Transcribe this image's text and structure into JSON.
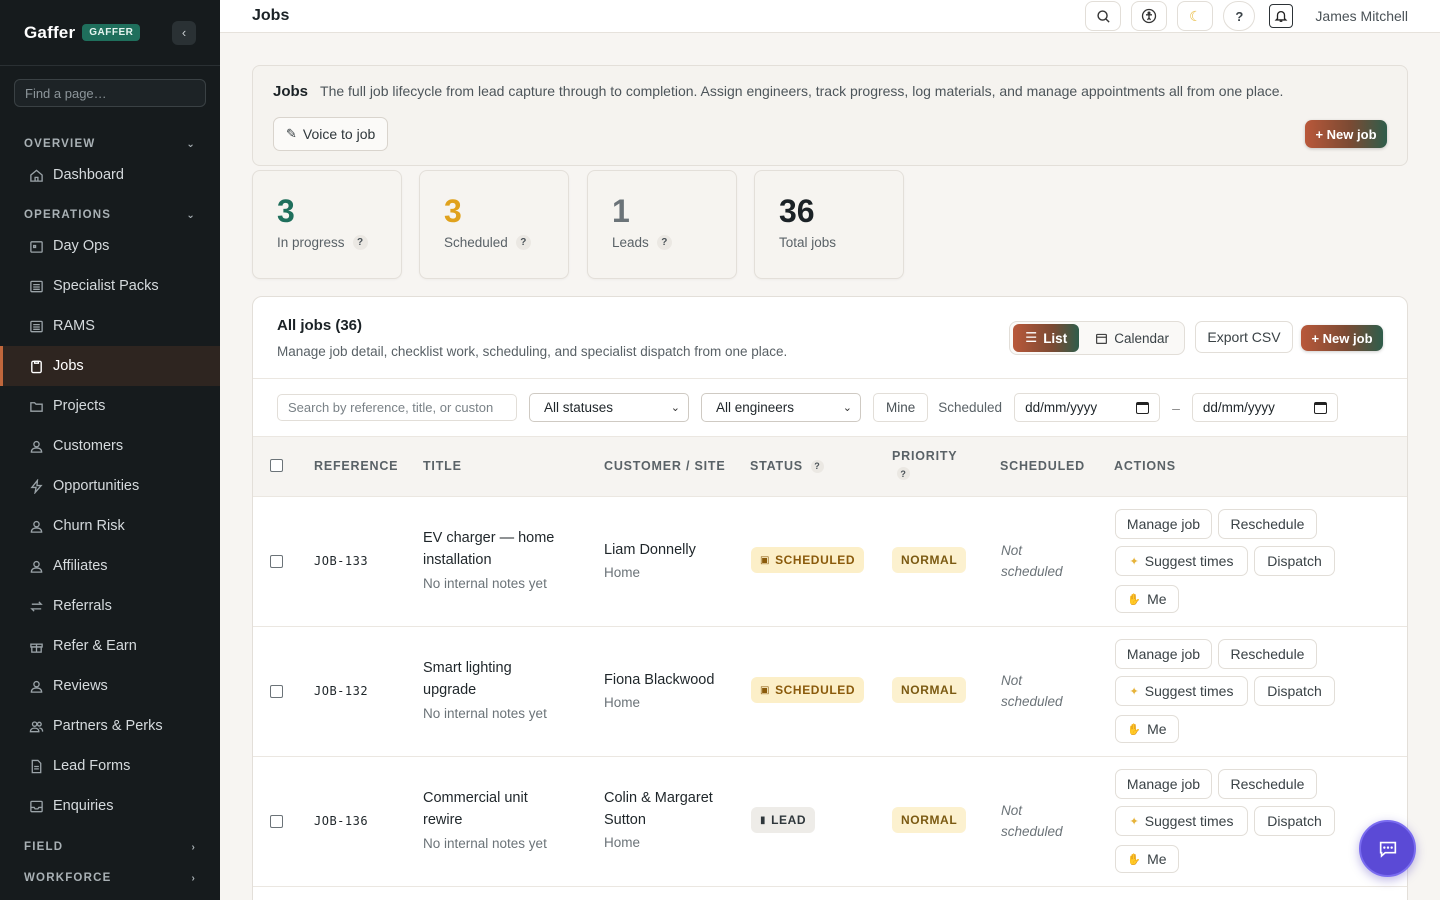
{
  "app": {
    "name": "Gaffer",
    "badge": "GAFFER"
  },
  "sidebar": {
    "search_placeholder": "Find a page…",
    "sections": [
      {
        "label": "OVERVIEW",
        "items": [
          {
            "label": "Dashboard",
            "icon": "home-icon"
          }
        ]
      },
      {
        "label": "OPERATIONS",
        "items": [
          {
            "label": "Day Ops",
            "icon": "calendar-icon"
          },
          {
            "label": "Specialist Packs",
            "icon": "list-icon"
          },
          {
            "label": "RAMS",
            "icon": "list-icon"
          },
          {
            "label": "Jobs",
            "icon": "clipboard-icon",
            "active": true
          },
          {
            "label": "Projects",
            "icon": "folder-icon"
          },
          {
            "label": "Customers",
            "icon": "user-icon"
          },
          {
            "label": "Opportunities",
            "icon": "bolt-icon"
          },
          {
            "label": "Churn Risk",
            "icon": "user-icon"
          },
          {
            "label": "Affiliates",
            "icon": "user-icon"
          },
          {
            "label": "Referrals",
            "icon": "swap-icon"
          },
          {
            "label": "Refer & Earn",
            "icon": "gift-icon"
          },
          {
            "label": "Reviews",
            "icon": "user-icon"
          },
          {
            "label": "Partners & Perks",
            "icon": "users-icon"
          },
          {
            "label": "Lead Forms",
            "icon": "document-icon"
          },
          {
            "label": "Enquiries",
            "icon": "inbox-icon"
          }
        ]
      },
      {
        "label": "FIELD",
        "items": []
      },
      {
        "label": "WORKFORCE",
        "items": []
      }
    ]
  },
  "topbar": {
    "title": "Jobs",
    "user": "James Mitchell"
  },
  "intro": {
    "title": "Jobs",
    "description": "The full job lifecycle from lead capture through to completion. Assign engineers, track progress, log materials, and manage appointments all from one place.",
    "voice_button": "Voice to job",
    "new_job": "+ New job"
  },
  "stats": [
    {
      "value": "3",
      "label": "In progress",
      "help": "?",
      "color": "#1f6f5c"
    },
    {
      "value": "3",
      "label": "Scheduled",
      "help": "?",
      "color": "#e0a21d"
    },
    {
      "value": "1",
      "label": "Leads",
      "help": "?",
      "color": "#6b7378"
    },
    {
      "value": "36",
      "label": "Total jobs",
      "help": "",
      "color": "#1b2226"
    }
  ],
  "panel": {
    "title": "All jobs (36)",
    "subtitle": "Manage job detail, checklist work, scheduling, and specialist dispatch from one place.",
    "view_list": "List",
    "view_calendar": "Calendar",
    "export": "Export CSV",
    "new_job": "+ New job"
  },
  "filters": {
    "search_placeholder": "Search by reference, title, or custon",
    "status": "All statuses",
    "engineer": "All engineers",
    "mine": "Mine",
    "scheduled_label": "Scheduled",
    "date_from": "dd/mm/yyyy",
    "date_to": "dd/mm/yyyy",
    "range_sep": "–"
  },
  "columns": {
    "reference": "REFERENCE",
    "title": "TITLE",
    "customer": "CUSTOMER / SITE",
    "status": "STATUS",
    "priority": "PRIORITY",
    "scheduled": "SCHEDULED",
    "actions": "ACTIONS",
    "help": "?"
  },
  "actions": {
    "manage": "Manage job",
    "reschedule": "Reschedule",
    "suggest": "Suggest times",
    "dispatch": "Dispatch",
    "me": "Me"
  },
  "rows": [
    {
      "ref": "JOB-133",
      "title_line1": "EV charger — home",
      "title_line2": "installation",
      "note": "No internal notes yet",
      "customer_line1": "Liam Donnelly",
      "customer_line2": "",
      "site": "Home",
      "status": "SCHEDULED",
      "status_kind": "scheduled",
      "priority": "NORMAL",
      "sched_line1": "Not",
      "sched_line2": "scheduled"
    },
    {
      "ref": "JOB-132",
      "title_line1": "Smart lighting",
      "title_line2": "upgrade",
      "note": "No internal notes yet",
      "customer_line1": "Fiona Blackwood",
      "customer_line2": "",
      "site": "Home",
      "status": "SCHEDULED",
      "status_kind": "scheduled",
      "priority": "NORMAL",
      "sched_line1": "Not",
      "sched_line2": "scheduled"
    },
    {
      "ref": "JOB-136",
      "title_line1": "Commercial unit",
      "title_line2": "rewire",
      "note": "No internal notes yet",
      "customer_line1": "Colin & Margaret",
      "customer_line2": "Sutton",
      "site": "Home",
      "status": "LEAD",
      "status_kind": "lead",
      "priority": "NORMAL",
      "sched_line1": "Not",
      "sched_line2": "scheduled"
    }
  ]
}
